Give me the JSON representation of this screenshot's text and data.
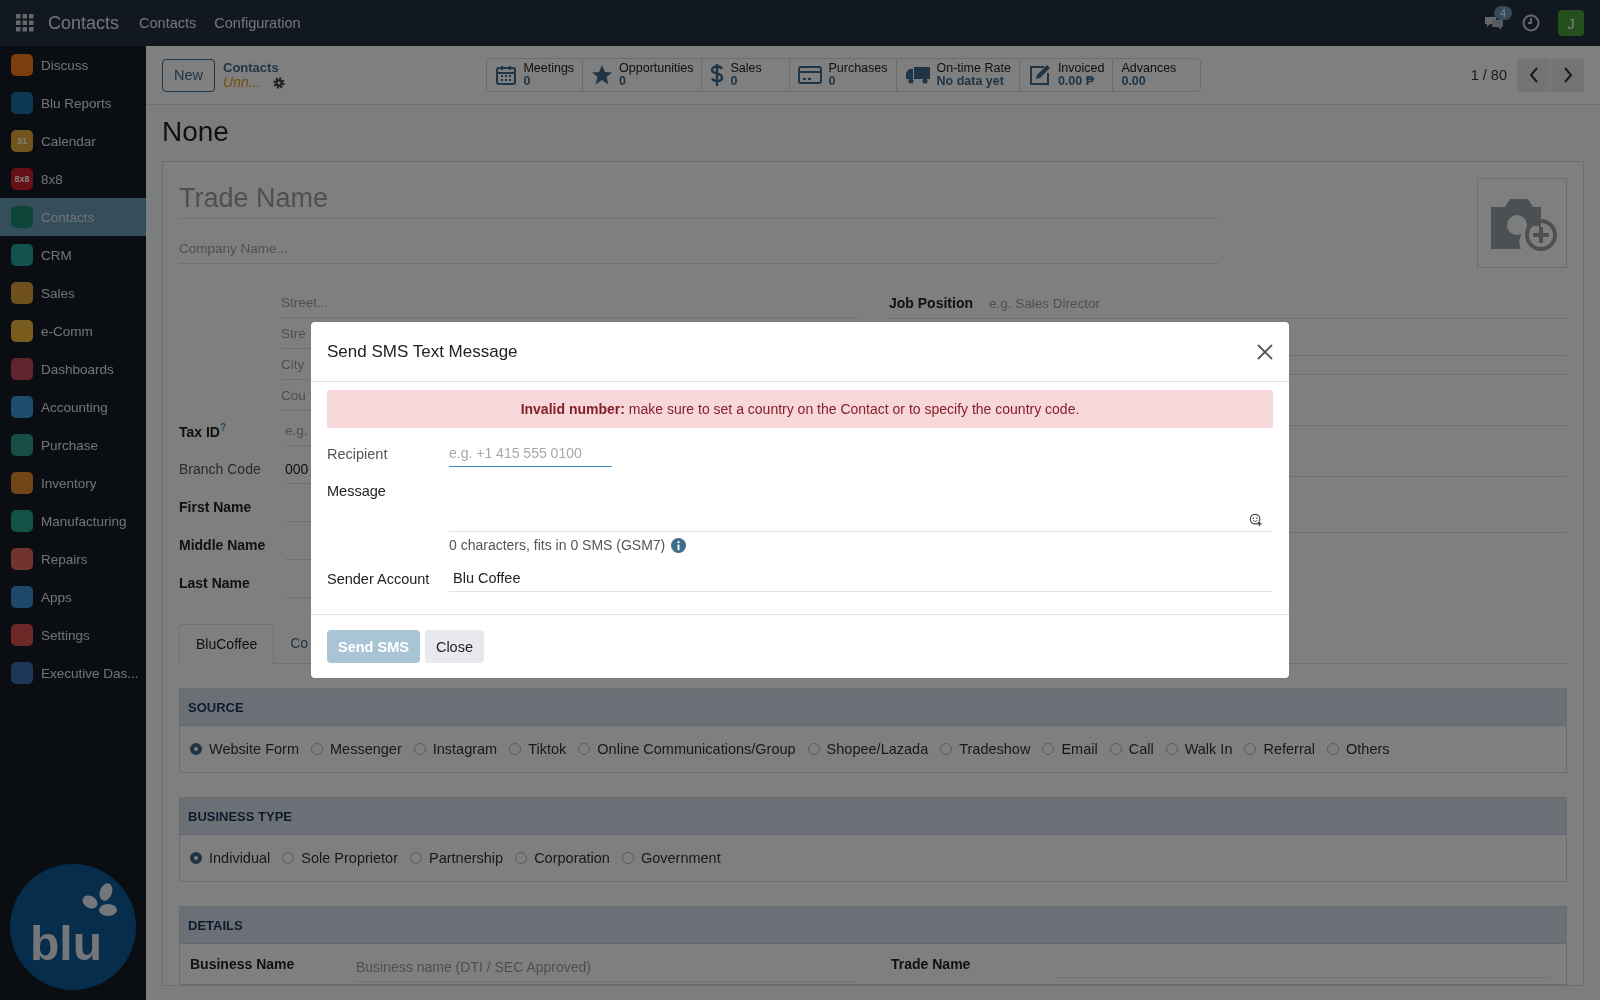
{
  "navbar": {
    "app_name": "Contacts",
    "menus": [
      "Contacts",
      "Configuration"
    ],
    "chat_count": "4",
    "user_initial": "J"
  },
  "sidebar": {
    "items": [
      {
        "label": "Discuss",
        "selected": false
      },
      {
        "label": "Blu Reports",
        "selected": false
      },
      {
        "label": "Calendar",
        "selected": false,
        "icon_text": "31"
      },
      {
        "label": "8x8",
        "selected": false,
        "icon_text": "8x8"
      },
      {
        "label": "Contacts",
        "selected": true
      },
      {
        "label": "CRM",
        "selected": false
      },
      {
        "label": "Sales",
        "selected": false
      },
      {
        "label": "e-Comm",
        "selected": false
      },
      {
        "label": "Dashboards",
        "selected": false
      },
      {
        "label": "Accounting",
        "selected": false
      },
      {
        "label": "Purchase",
        "selected": false
      },
      {
        "label": "Inventory",
        "selected": false
      },
      {
        "label": "Manufacturing",
        "selected": false
      },
      {
        "label": "Repairs",
        "selected": false
      },
      {
        "label": "Apps",
        "selected": false
      },
      {
        "label": "Settings",
        "selected": false
      },
      {
        "label": "Executive Das...",
        "selected": false
      }
    ],
    "logo_text": "blu"
  },
  "control_panel": {
    "new_button": "New",
    "breadcrumb": "Contacts",
    "record": "Unn...",
    "pager": "1 / 80",
    "stats": [
      {
        "kind": "calendar",
        "label": "Meetings",
        "value": "0"
      },
      {
        "kind": "star",
        "label": "Opportunities",
        "value": "0"
      },
      {
        "kind": "dollar",
        "label": "Sales",
        "value": "0"
      },
      {
        "kind": "card",
        "label": "Purchases",
        "value": "0"
      },
      {
        "kind": "truck",
        "label": "On-time Rate",
        "value": "No data yet"
      },
      {
        "kind": "edit",
        "label": "Invoiced",
        "value": "0.00 ₱"
      },
      {
        "kind": "none",
        "label": "Advances",
        "value": "0.00"
      }
    ]
  },
  "title": "None",
  "form": {
    "trade_name_placeholder": "Trade Name",
    "company_placeholder": "Company Name...",
    "address": [
      "Street...",
      "Stre",
      "City",
      "Cou"
    ],
    "fields": [
      {
        "label": "Tax ID",
        "help": "?",
        "placeholder": "e.g.",
        "readonly": false
      },
      {
        "label": "Branch Code",
        "value": "000",
        "readonly": true
      },
      {
        "label": "First Name",
        "readonly": false
      },
      {
        "label": "Middle Name",
        "readonly": false
      },
      {
        "label": "Last Name",
        "readonly": false
      }
    ],
    "job_position": {
      "label": "Job Position",
      "placeholder": "e.g. Sales Director"
    },
    "tabs": [
      {
        "label": "BluCoffee",
        "selected": true
      },
      {
        "label": "Co",
        "selected": false
      }
    ],
    "sections": [
      {
        "title": "SOURCE",
        "options": [
          {
            "label": "Website Form",
            "selected": true
          },
          {
            "label": "Messenger",
            "selected": false
          },
          {
            "label": "Instagram",
            "selected": false
          },
          {
            "label": "Tiktok",
            "selected": false
          },
          {
            "label": "Online Communications/Group",
            "selected": false
          },
          {
            "label": "Shopee/Lazada",
            "selected": false
          },
          {
            "label": "Tradeshow",
            "selected": false
          },
          {
            "label": "Email",
            "selected": false
          },
          {
            "label": "Call",
            "selected": false
          },
          {
            "label": "Walk In",
            "selected": false
          },
          {
            "label": "Referral",
            "selected": false
          },
          {
            "label": "Others",
            "selected": false
          }
        ]
      },
      {
        "title": "BUSINESS TYPE",
        "options": [
          {
            "label": "Individual",
            "selected": true
          },
          {
            "label": "Sole Proprietor",
            "selected": false
          },
          {
            "label": "Partnership",
            "selected": false
          },
          {
            "label": "Corporation",
            "selected": false
          },
          {
            "label": "Government",
            "selected": false
          }
        ]
      }
    ],
    "details": {
      "title": "DETAILS",
      "left_label": "Business Name",
      "left_placeholder": "Business name (DTI / SEC Approved)",
      "right_label": "Trade Name"
    }
  },
  "dialog": {
    "title": "Send SMS Text Message",
    "alert_bold": "Invalid number:",
    "alert_text": "make sure to set a country on the Contact or to specify the country code.",
    "recipient_label": "Recipient",
    "recipient_placeholder": "e.g. +1 415 555 0100",
    "message_label": "Message",
    "counter": "0 characters, fits in 0 SMS (GSM7)",
    "sender_label": "Sender Account",
    "sender_value": "Blu Coffee",
    "buttons": [
      {
        "label": "Send SMS",
        "kind": "primary",
        "disabled": true
      },
      {
        "label": "Close",
        "kind": "secondary",
        "disabled": false
      }
    ]
  }
}
